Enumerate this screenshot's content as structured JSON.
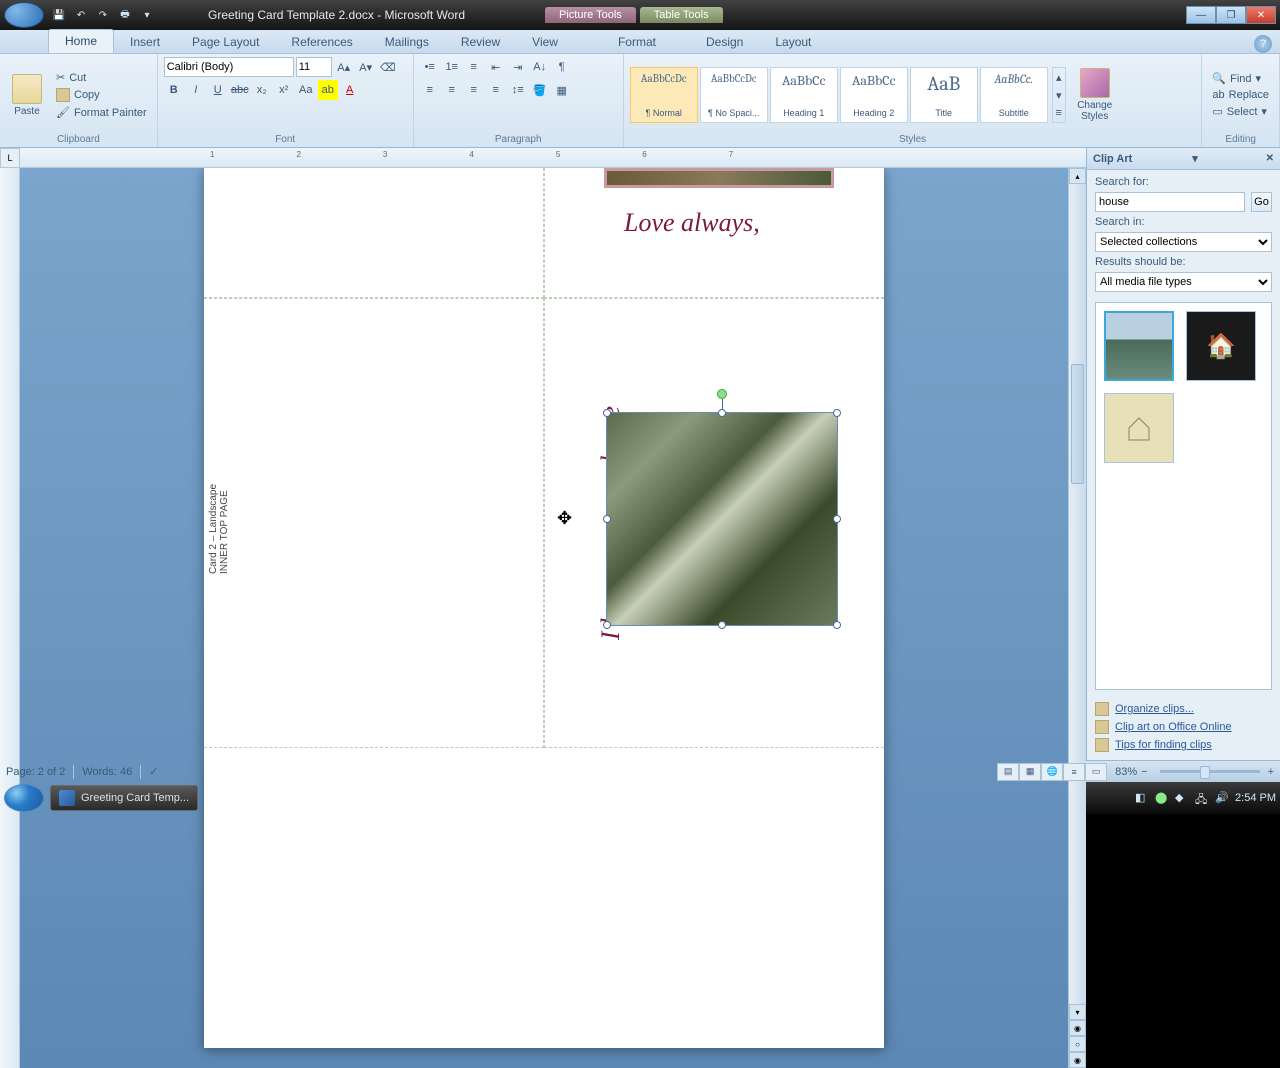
{
  "titlebar": {
    "title": "Greeting Card Template 2.docx - Microsoft Word",
    "context_tabs": [
      "Picture Tools",
      "Table Tools"
    ]
  },
  "ribbon_tabs": [
    "Home",
    "Insert",
    "Page Layout",
    "References",
    "Mailings",
    "Review",
    "View"
  ],
  "context_ribbon_tabs": [
    "Format",
    "Design",
    "Layout"
  ],
  "clipboard": {
    "paste": "Paste",
    "cut": "Cut",
    "copy": "Copy",
    "format_painter": "Format Painter",
    "label": "Clipboard"
  },
  "font": {
    "name": "Calibri (Body)",
    "size": "11",
    "label": "Font"
  },
  "paragraph": {
    "label": "Paragraph"
  },
  "styles": {
    "label": "Styles",
    "items": [
      {
        "preview": "AaBbCcDc",
        "name": "¶ Normal"
      },
      {
        "preview": "AaBbCcDc",
        "name": "¶ No Spaci..."
      },
      {
        "preview": "AaBbCc",
        "name": "Heading 1"
      },
      {
        "preview": "AaBbCc",
        "name": "Heading 2"
      },
      {
        "preview": "AaB",
        "name": "Title"
      },
      {
        "preview": "AaBbCc.",
        "name": "Subtitle"
      }
    ],
    "change_styles": "Change Styles"
  },
  "editing": {
    "find": "Find",
    "replace": "Replace",
    "select": "Select",
    "label": "Editing"
  },
  "document": {
    "love_always": "Love always,",
    "hope_home": "I hope you come home",
    "love_always_2": "Love always,",
    "card_label_1": "Card 2 – Landscape",
    "card_label_2": "INNER TOP PAGE"
  },
  "clipart": {
    "title": "Clip Art",
    "search_for_label": "Search for:",
    "search_value": "house",
    "go": "Go",
    "search_in_label": "Search in:",
    "search_in_value": "Selected collections",
    "results_label": "Results should be:",
    "results_value": "All media file types",
    "organize": "Organize clips...",
    "office_online": "Clip art on Office Online",
    "tips": "Tips for finding clips"
  },
  "statusbar": {
    "page": "Page: 2 of 2",
    "words": "Words: 46",
    "zoom": "83%"
  },
  "taskbar": {
    "app": "Greeting Card Temp...",
    "time": "2:54 PM"
  }
}
